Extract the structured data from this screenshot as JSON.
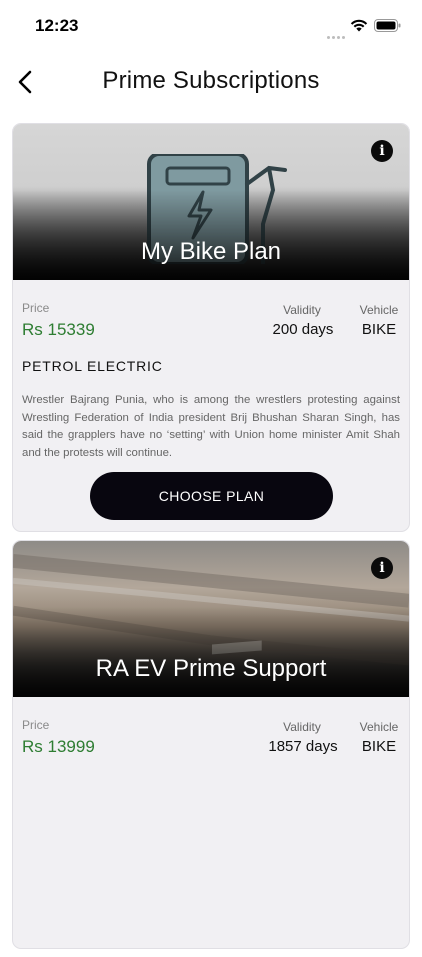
{
  "status_bar": {
    "time": "12:23"
  },
  "header": {
    "title": "Prime Subscriptions",
    "back_icon": "chevron-left-icon"
  },
  "labels": {
    "price": "Price",
    "validity": "Validity",
    "vehicle": "Vehicle",
    "choose": "CHOOSE PLAN"
  },
  "plans": [
    {
      "name": "My Bike Plan",
      "price": "Rs 15339",
      "validity": "200 days",
      "vehicle": "BIKE",
      "type": "PETROL ELECTRIC",
      "description": "Wrestler Bajrang Punia, who is among the wrestlers protesting against Wrestling Federation of India president Brij Bhushan Sharan Singh, has said the grapplers have no ‘setting’ with Union home minister Amit Shah and the protests will continue."
    },
    {
      "name": "RA EV Prime Support",
      "price": "Rs 13999",
      "validity": "1857 days",
      "vehicle": "BIKE"
    }
  ],
  "colors": {
    "price": "#2e7d32",
    "button": "#08060f",
    "card": "#f1f0f3"
  }
}
